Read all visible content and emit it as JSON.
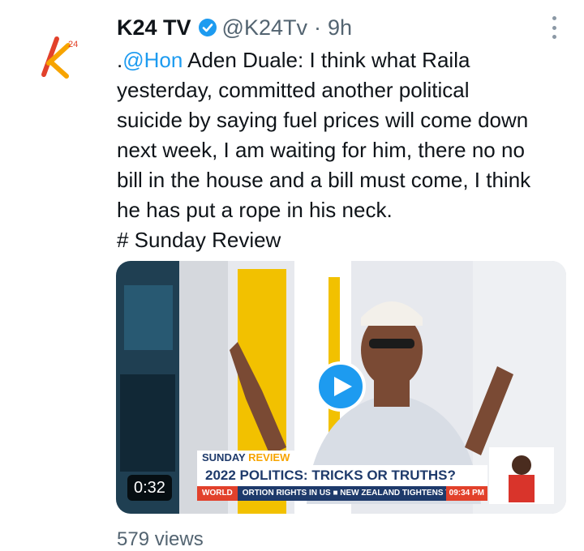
{
  "tweet": {
    "display_name": "K24 TV",
    "handle": "@K24Tv",
    "separator": "·",
    "time": "9h",
    "text_lines": [
      {
        "prefix": ".",
        "mention": "@Hon",
        "rest": " Aden Duale: I think what Raila"
      },
      {
        "text": "yesterday, committed another political"
      },
      {
        "text": "suicide by saying fuel prices will come down"
      },
      {
        "text": "next week, I am waiting for him, there no no"
      },
      {
        "text": "bill in the house and a bill must come, I think"
      },
      {
        "text": "he has put a rope in his neck."
      },
      {
        "text": "# Sunday Review"
      }
    ],
    "views": "579 views"
  },
  "video": {
    "duration": "0:32",
    "show_label": "SUNDAY",
    "show_label_accent": "REVIEW",
    "headline": "2022 POLITICS: TRICKS OR TRUTHS?",
    "ticker_tag": "WORLD",
    "ticker_text": "ORTION RIGHTS IN US ■ NEW ZEALAND TIGHTENS TRAVEL",
    "ticker_time": "09:34 PM",
    "logo_superscript": "24"
  },
  "icons": {
    "avatar": "k24-logo-icon",
    "verified": "verified-badge-icon",
    "more": "more-options-icon",
    "play": "play-icon"
  },
  "colors": {
    "accent_blue": "#1d9bf0",
    "secondary_text": "#536471",
    "brand_orange": "#f7a400",
    "brand_red": "#e2412b"
  }
}
